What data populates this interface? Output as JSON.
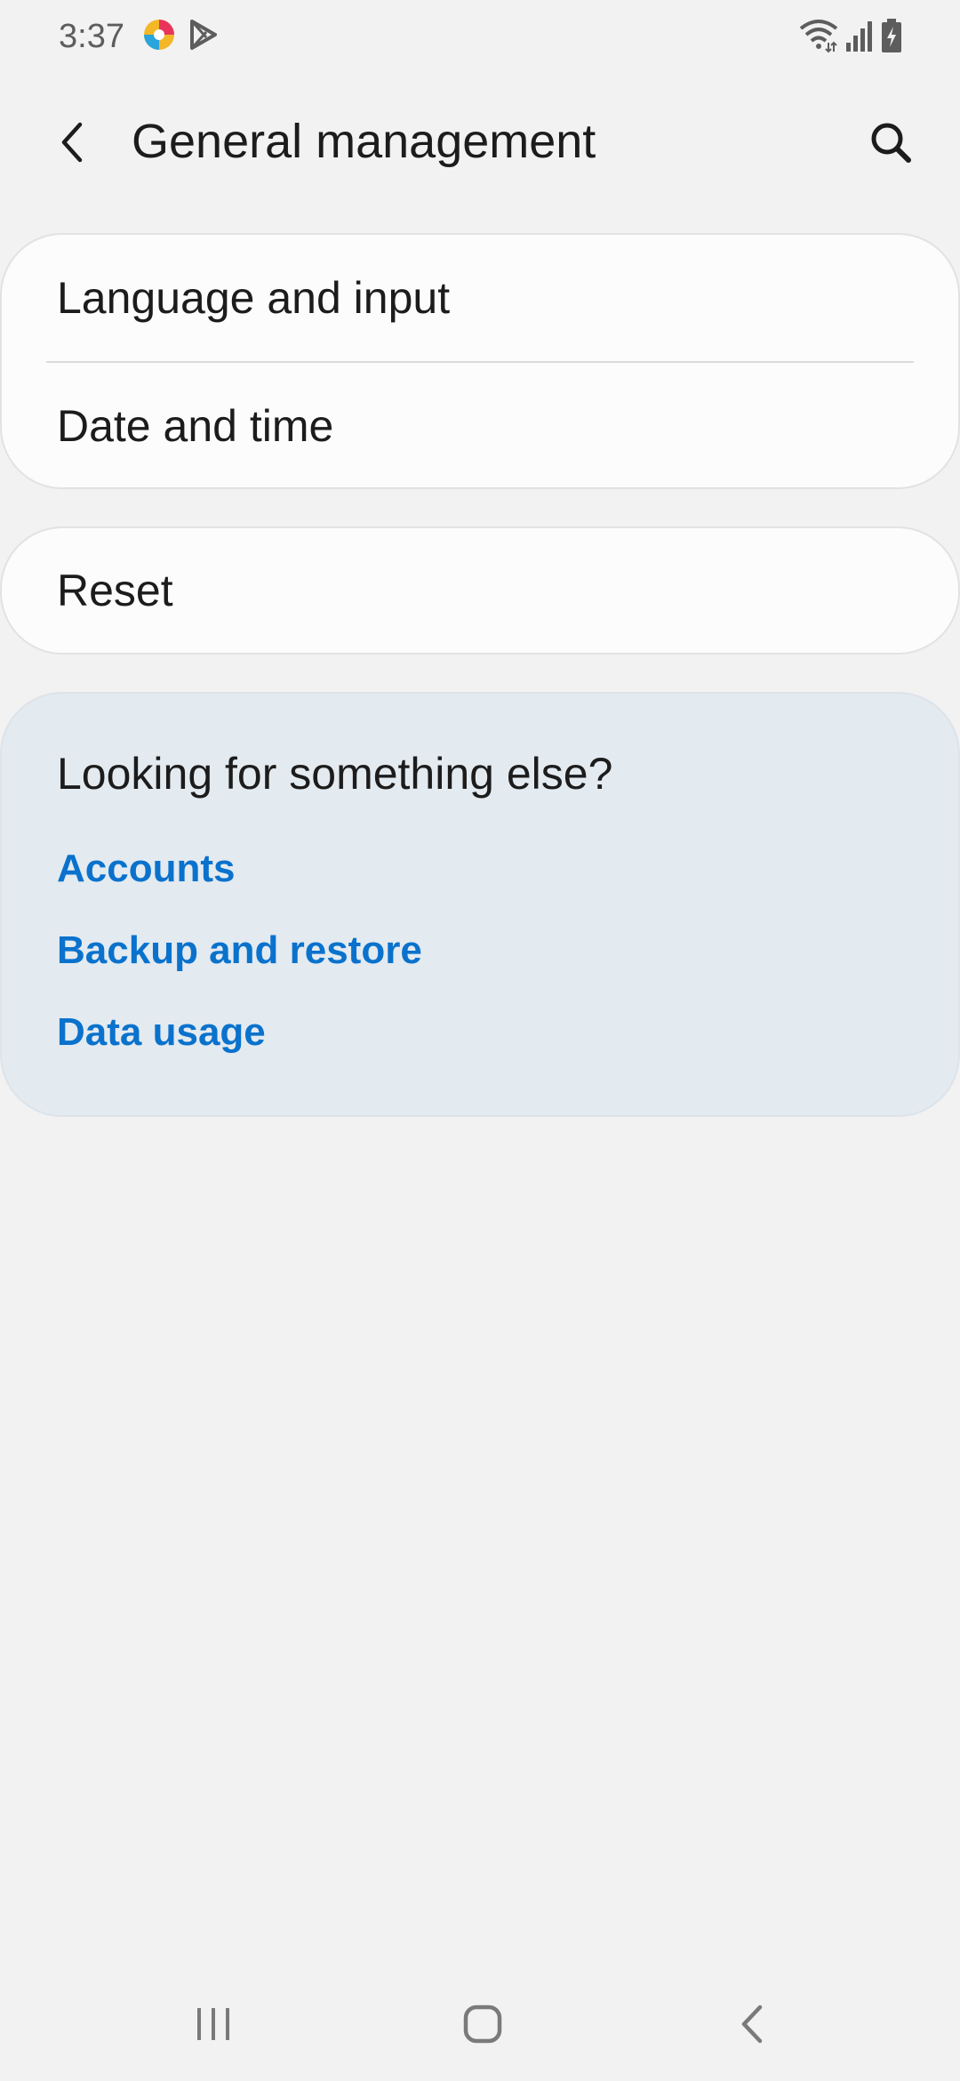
{
  "status_bar": {
    "time": "3:37",
    "left_icons": [
      "app-notification-icon",
      "play-store-icon"
    ],
    "right_icons": [
      "wifi-icon",
      "signal-icon",
      "battery-charging-icon"
    ]
  },
  "header": {
    "back_icon": "chevron-left-icon",
    "title": "General management",
    "search_icon": "search-icon"
  },
  "settings_groups": [
    {
      "items": [
        {
          "label": "Language and input"
        },
        {
          "label": "Date and time"
        }
      ]
    },
    {
      "items": [
        {
          "label": "Reset"
        }
      ]
    }
  ],
  "suggestions": {
    "title": "Looking for something else?",
    "links": [
      {
        "label": "Accounts"
      },
      {
        "label": "Backup and restore"
      },
      {
        "label": "Data usage"
      }
    ]
  },
  "navigation_bar": {
    "buttons": [
      "recents-icon",
      "home-icon",
      "back-icon"
    ]
  },
  "colors": {
    "background": "#f2f2f2",
    "card": "#fcfcfc",
    "suggestion_card": "#e3eaf0",
    "link": "#0a72cc",
    "text": "#1c1c1c"
  }
}
